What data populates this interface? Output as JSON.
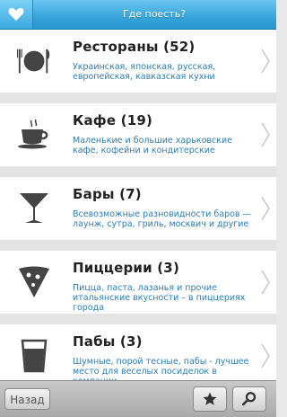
{
  "header": {
    "title": "Где поесть?"
  },
  "categories": [
    {
      "title": "Рестораны (52)",
      "description": "Украинская, японская, русская, европейская, кавказская кухни",
      "icon": "plate-cutlery-icon"
    },
    {
      "title": "Кафе (19)",
      "description": "Маленькие и большие харьковские кафе, кофейни и кондитерские",
      "icon": "coffee-cup-icon"
    },
    {
      "title": "Бары (7)",
      "description": "Всевозможные разновидности баров — лаунж, сутра, гриль, москвич и другие",
      "icon": "cocktail-glass-icon"
    },
    {
      "title": "Пиццерии (3)",
      "description": "Пицца, паста, лазанья и прочие итальянские вкусности – в пиццериях города",
      "icon": "pizza-slice-icon"
    },
    {
      "title": "Пабы (3)",
      "description": "Шумные, порой тесные, пабы - лучшее место для веселых посиделок в компании",
      "icon": "beer-glass-icon"
    }
  ],
  "footer": {
    "back_label": "Назад",
    "favorites_icon": "star-icon",
    "search_icon": "search-icon"
  },
  "colors": {
    "header": "#3aa7dd",
    "description_text": "#2b7dbf"
  }
}
